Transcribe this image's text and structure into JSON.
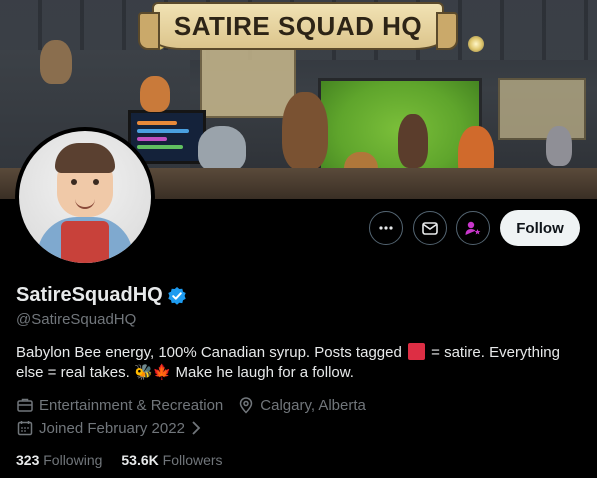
{
  "banner": {
    "title": "SATIRE SQUAD HQ"
  },
  "profile": {
    "display_name": "SatireSquadHQ",
    "handle": "@SatireSquadHQ",
    "verified_icon": "verified-badge-icon",
    "bio_part1": "Babylon Bee energy, 100% Canadian syrup. Posts tagged ",
    "bio_part2": " = satire. Everything else = real takes. ",
    "bio_emoji": "🐝🍁",
    "bio_part3": " Make he laugh for a follow.",
    "category": "Entertainment & Recreation",
    "location": "Calgary, Alberta",
    "joined": "Joined February 2022",
    "following_count": "323",
    "following_label": "Following",
    "followers_count": "53.6K",
    "followers_label": "Followers"
  },
  "actions": {
    "follow_label": "Follow",
    "more_icon": "more-icon",
    "message_icon": "mail-icon",
    "subscribe_icon": "subscribe-person-icon"
  },
  "colors": {
    "background": "#000000",
    "text_primary": "#e7e9ea",
    "text_secondary": "#71767b",
    "verified_blue": "#1d9bf0",
    "subscribe_purple": "#c936cc",
    "follow_button_bg": "#eff3f4"
  }
}
